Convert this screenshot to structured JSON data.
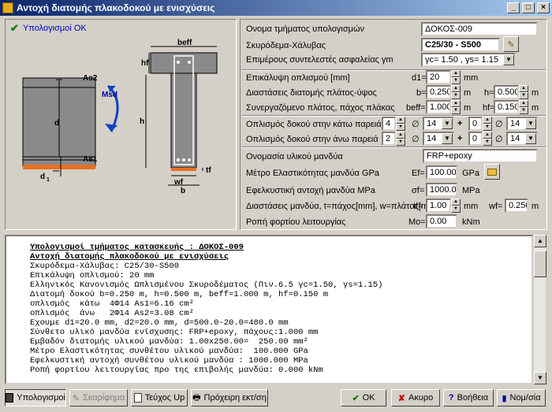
{
  "window": {
    "title": "Αντοχή διατομής πλακοδοκού με ενισχύσεις",
    "min": "_",
    "max": "□",
    "close": "×"
  },
  "status": {
    "text": "Υπολογισμοί ΟΚ"
  },
  "diagram": {
    "labels": {
      "beff": "beff",
      "as2": "As2",
      "msd": "Msd",
      "d": "d",
      "h": "h",
      "as1": "As1",
      "d1": "d",
      "d1sub": "1",
      "hf": "hf",
      "tf": "tf",
      "wf": "wf",
      "b": "b"
    }
  },
  "form": {
    "section_name": {
      "label": "Ονομα τμήματος υπολογισμών",
      "value": "ΔΟΚΟΣ-009"
    },
    "concrete": {
      "label": "Σκυρόδεμα-Χάλυβας",
      "value": "C25/30 - S500"
    },
    "safety": {
      "label": "Επιμέρους συντελεστές ασφαλείας γm",
      "value": "γc= 1.50 , γs= 1.15"
    },
    "cover": {
      "label": "Επικάλυψη οπλισμού [mm]",
      "sym": "d1=",
      "value": "20",
      "unit": "mm"
    },
    "dims": {
      "label": "Διαστάσεις διατομής πλάτος-ύψος",
      "b_sym": "b=",
      "b": "0.250",
      "b_unit": "m",
      "h_sym": "h=",
      "h": "0.500",
      "h_unit": "m"
    },
    "flange": {
      "label": "Συνεργαζόμενο πλάτος, πάχος πλάκας",
      "beff_sym": "beff=",
      "beff": "1.000",
      "beff_unit": "m",
      "hf_sym": "hf=",
      "hf": "0.150",
      "hf_unit": "m"
    },
    "bottom": {
      "label": "Οπλισμός δοκού στην κάτω παρειά",
      "n1": "4",
      "d1": "14",
      "n2": "0",
      "d2": "14"
    },
    "top": {
      "label": "Οπλισμός δοκού στην άνω παρειά",
      "n1": "2",
      "d1": "14",
      "n2": "0",
      "d2": "14"
    },
    "dia_sym": "∅",
    "plus": "+",
    "material": {
      "label": "Ονομασία υλικού μανδύα",
      "value": "FRP+epoxy"
    },
    "modulus": {
      "label": "Μέτρο Ελαστικότητας μανδύα GPa",
      "sym": "Ef=",
      "value": "100.00",
      "unit": "GPa"
    },
    "tensile": {
      "label": "Εφελκυστική αντοχή μανδύα MPa",
      "sym": "σf=",
      "value": "1000.00",
      "unit": "MPa"
    },
    "jacket": {
      "label": "Διαστάσεις μανδύα, t=πάχος[mm], w=πλάτος[m]",
      "tf_sym": "tf=",
      "tf": "1.00",
      "tf_unit": "mm",
      "wf_sym": "wf=",
      "wf": "0.250",
      "wf_unit": "m"
    },
    "moment": {
      "label": "Ροπή φορτίου λειτουργίας",
      "sym": "Mo=",
      "value": "0.00",
      "unit": "kNm"
    }
  },
  "report": {
    "lines": [
      {
        "t": "Υπολογισμοί τμήματος κατασκευής : ΔΟΚΟΣ-009",
        "bold": true
      },
      {
        "t": "Αντοχή διατομής πλακοδοκού με ενισχύσεις",
        "bold": true
      },
      {
        "t": "Σκυρόδεμα-Χάλυβας: C25/30-S500",
        "bold": false
      },
      {
        "t": "Επικάλυψη οπλισμού: 20 mm",
        "bold": false
      },
      {
        "t": "Ελληνικός Κανονισμός Ωπλισμένου Σκυροδέματος (Πιν.6.5 γc=1.50, γs=1.15)",
        "bold": false
      },
      {
        "t": "Διατομή δοκού b=0.250 m, h=0.500 m, beff=1.000 m, hf=0.150 m",
        "bold": false
      },
      {
        "t": "οπλισμός  κάτω  4Φ14 As1=6.16 cm²",
        "bold": false
      },
      {
        "t": "οπλισμός  άνω   2Φ14 As2=3.08 cm²",
        "bold": false
      },
      {
        "t": "Εχουμε d1=20.0 mm, d2=20.0 mm, d=500.0-20.0=480.0 mm",
        "bold": false
      },
      {
        "t": "Σύνθετο υλικό μανδύα ενίσχυσης: FRP+epoxy, πάχους:1.000 mm",
        "bold": false
      },
      {
        "t": "Εμβαδόν διατομής υλικού μανδύα: 1.00x250.00=  250.00 mm²",
        "bold": false
      },
      {
        "t": "Μέτρο Ελαστικότητας συνθέτου υλικού μανδύα:  100.000 GPa",
        "bold": false
      },
      {
        "t": "Εφελκυστική αντοχή συνθέτου υλικού μανδύα : 1000.000 MPa",
        "bold": false
      },
      {
        "t": "Ροπή φορτίου λειτουργίας προ της επιβολής μανδύα: 0.000 kNm",
        "bold": false
      }
    ]
  },
  "buttons": {
    "calc": "Υπολογισμοί",
    "sketch": "Σκαρίφημα",
    "teuxos": "Τεύχος Up",
    "print": "Πρόχειρη εκτ/ση",
    "ok": "ΟΚ",
    "cancel": "Ακυρο",
    "help": "Βοήθεια",
    "units": "Νομ/σία"
  }
}
